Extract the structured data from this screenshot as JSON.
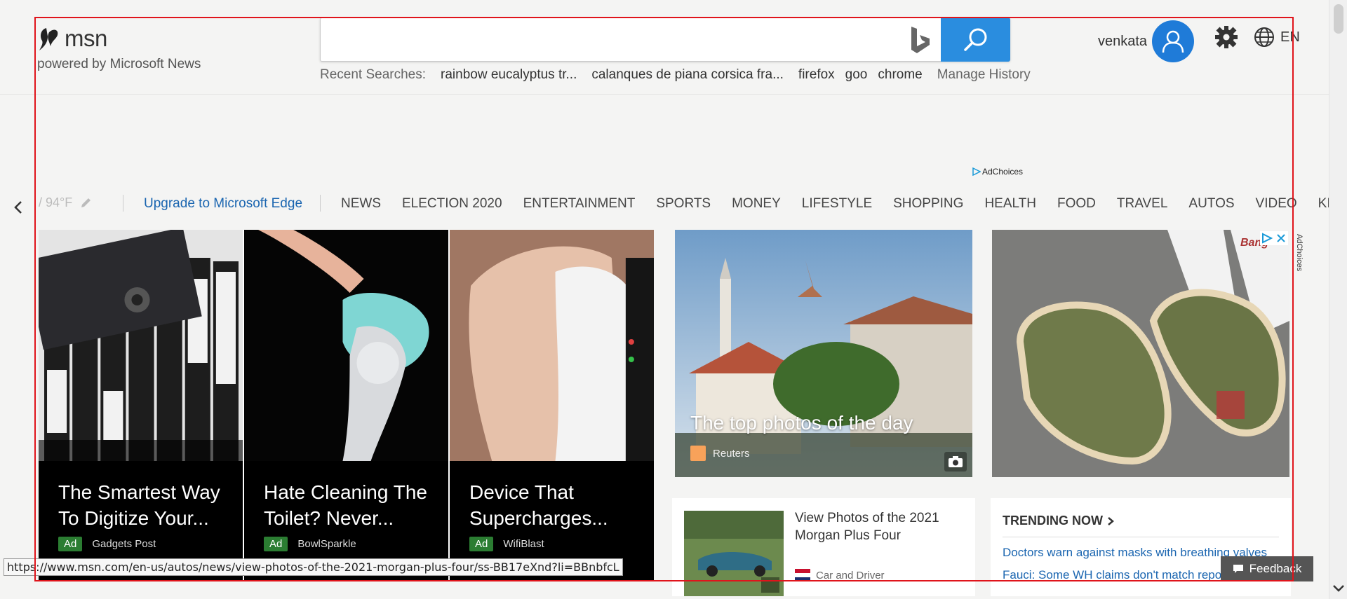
{
  "header": {
    "logo_text": "msn",
    "powered_by": "powered by Microsoft News",
    "search_placeholder": "",
    "recent_label": "Recent Searches:",
    "recent_searches": [
      "rainbow eucalyptus tr...",
      "calanques de piana corsica fra...",
      "firefox",
      "goo",
      "chrome"
    ],
    "manage_history": "Manage History",
    "user_name": "venkata",
    "language": "EN"
  },
  "ad_choices_label": "AdChoices",
  "nav": {
    "weather": "/ 94°F",
    "edge_link": "Upgrade to Microsoft Edge",
    "items": [
      "NEWS",
      "ELECTION 2020",
      "ENTERTAINMENT",
      "SPORTS",
      "MONEY",
      "LIFESTYLE",
      "SHOPPING",
      "HEALTH",
      "FOOD",
      "TRAVEL",
      "AUTOS",
      "VIDEO",
      "KIDS"
    ]
  },
  "ads": [
    {
      "title": "The Smartest Way To Digitize Your...",
      "badge": "Ad",
      "source": "Gadgets Post"
    },
    {
      "title": "Hate Cleaning The Toilet? Never...",
      "badge": "Ad",
      "source": "BowlSparkle"
    },
    {
      "title": "Device That Supercharges...",
      "badge": "Ad",
      "source": "WifiBlast"
    }
  ],
  "hero": {
    "title": "The top photos of the day",
    "source": "Reuters"
  },
  "shoe_ad": {
    "brand": "Bang"
  },
  "news_card": {
    "title": "View Photos of the 2021 Morgan Plus Four",
    "source": "Car and Driver"
  },
  "trending": {
    "heading": "TRENDING NOW",
    "links": [
      "Doctors warn against masks with breathing valves",
      "Fauci: Some WH claims don't match reporting"
    ]
  },
  "feedback_label": "Feedback",
  "status_url": "https://www.msn.com/en-us/autos/news/view-photos-of-the-2021-morgan-plus-four/ss-BB17eXnd?li=BBnbfcL",
  "colors": {
    "accent": "#2a8ddf",
    "link": "#1a65b0",
    "ad_badge": "#2b7d32",
    "selection": "#e0141b"
  }
}
